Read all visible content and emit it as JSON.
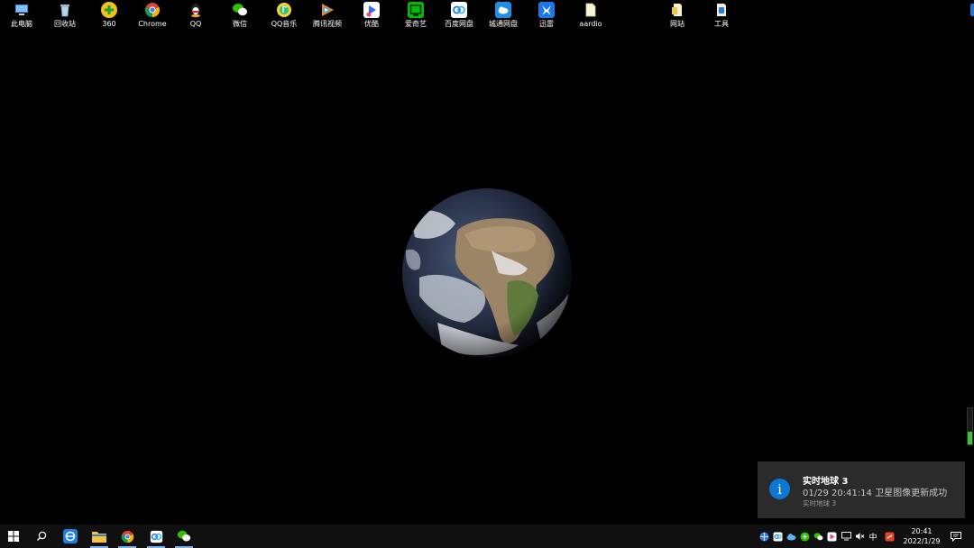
{
  "desktop": {
    "icons": [
      {
        "label": "此电脑",
        "icon": "computer-icon"
      },
      {
        "label": "回收站",
        "icon": "recycle-bin-icon"
      },
      {
        "label": "360",
        "icon": "security-360-icon"
      },
      {
        "label": "Chrome",
        "icon": "chrome-icon"
      },
      {
        "label": "QQ",
        "icon": "qq-icon"
      },
      {
        "label": "微信",
        "icon": "wechat-icon"
      },
      {
        "label": "QQ音乐",
        "icon": "qq-music-icon"
      },
      {
        "label": "腾讯视频",
        "icon": "tencent-video-icon"
      },
      {
        "label": "优酷",
        "icon": "youku-icon"
      },
      {
        "label": "爱奇艺",
        "icon": "iqiyi-icon"
      },
      {
        "label": "百度网盘",
        "icon": "baidu-netdisk-icon"
      },
      {
        "label": "城通网盘",
        "icon": "ctfile-icon"
      },
      {
        "label": "迅雷",
        "icon": "xunlei-icon"
      },
      {
        "label": "aardio",
        "icon": "aardio-file-icon"
      },
      {
        "label": "网站",
        "icon": "website-folder-icon"
      },
      {
        "label": "工具",
        "icon": "tools-icon"
      }
    ]
  },
  "notification": {
    "title": "实时地球 3",
    "body": "01/29 20:41:14 卫星图像更新成功",
    "source": "实时地球 3",
    "icon": "info-icon",
    "accent": "#0a78d4"
  },
  "taskbar": {
    "pinned": [
      {
        "icon": "start-windows-icon",
        "active": false
      },
      {
        "icon": "search-icon",
        "active": false
      },
      {
        "icon": "browser-e-icon",
        "active": false
      },
      {
        "icon": "file-explorer-icon",
        "active": true
      },
      {
        "icon": "chrome-icon",
        "active": true
      },
      {
        "icon": "baidu-netdisk-icon",
        "active": true
      },
      {
        "icon": "wechat-icon",
        "active": true
      }
    ],
    "tray": {
      "ime": "中",
      "time": "20:41",
      "date": "2022/1/29"
    }
  },
  "wallpaper": {
    "subject": "earth-globe-icon"
  },
  "colors": {
    "taskbar_bg": "#101010",
    "toast_bg": "#2b2b2b",
    "active_indicator": "#7db3e8"
  }
}
